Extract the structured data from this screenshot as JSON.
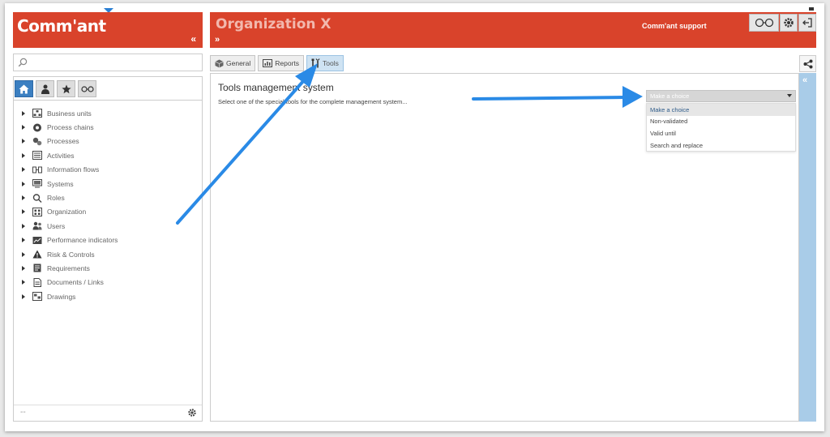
{
  "header": {
    "logo": "Comm'ant",
    "collapse_left": "«",
    "title": "Organization X",
    "expand_right": "»",
    "support_label": "Comm'ant support"
  },
  "search": {
    "placeholder": ""
  },
  "sidebar": {
    "tab_icons": [
      "home-icon",
      "user-icon",
      "star-icon",
      "glasses-icon"
    ],
    "items": [
      {
        "label": "Business units",
        "icon": "business-units-icon"
      },
      {
        "label": "Process chains",
        "icon": "process-chains-icon"
      },
      {
        "label": "Processes",
        "icon": "processes-icon"
      },
      {
        "label": "Activities",
        "icon": "activities-icon"
      },
      {
        "label": "Information flows",
        "icon": "information-flows-icon"
      },
      {
        "label": "Systems",
        "icon": "systems-icon"
      },
      {
        "label": "Roles",
        "icon": "roles-icon"
      },
      {
        "label": "Organization",
        "icon": "organization-icon"
      },
      {
        "label": "Users",
        "icon": "users-icon"
      },
      {
        "label": "Performance indicators",
        "icon": "performance-indicators-icon"
      },
      {
        "label": "Risk & Controls",
        "icon": "risk-controls-icon"
      },
      {
        "label": "Requirements",
        "icon": "requirements-icon"
      },
      {
        "label": "Documents / Links",
        "icon": "documents-links-icon"
      },
      {
        "label": "Drawings",
        "icon": "drawings-icon"
      }
    ],
    "footer_dash": "--"
  },
  "tabs": [
    {
      "label": "General",
      "icon": "cube-icon"
    },
    {
      "label": "Reports",
      "icon": "report-icon"
    },
    {
      "label": "Tools",
      "icon": "tools-icon"
    }
  ],
  "main": {
    "title": "Tools management system",
    "description": "Select one of the special tools for the complete management system..."
  },
  "select": {
    "value": "Make a choice",
    "options": [
      "Make a choice",
      "Non-validated",
      "Valid until",
      "Search and replace"
    ]
  },
  "strip": {
    "toggle": "«"
  },
  "colors": {
    "brand_red": "#d9432b",
    "tab_active": "#cfe3f3",
    "strip_blue": "#a9cce8",
    "arrow_blue": "#2a8ae6"
  }
}
